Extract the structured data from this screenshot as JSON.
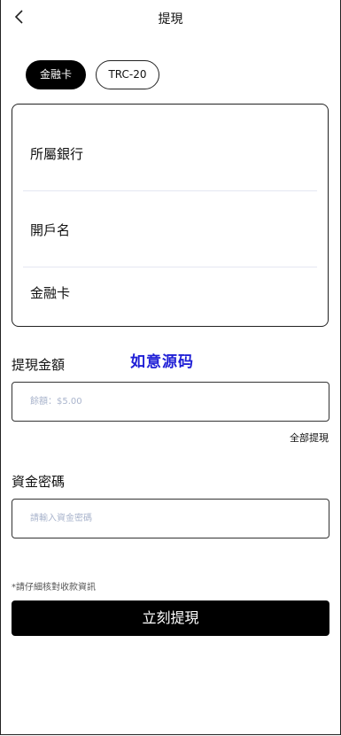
{
  "header": {
    "title": "提現",
    "back_icon": "chevron-left-icon"
  },
  "tabs": [
    {
      "label": "金融卡",
      "active": true
    },
    {
      "label": "TRC-20",
      "active": false
    }
  ],
  "bank_card": {
    "bank_label": "所屬銀行",
    "account_name_label": "開戶名",
    "card_label": "金融卡"
  },
  "amount": {
    "label": "提現金額",
    "placeholder": "餘額：$5.00",
    "withdraw_all": "全部提現"
  },
  "watermark": "如意源码",
  "password": {
    "label": "資金密碼",
    "placeholder": "請輸入資金密碼"
  },
  "notice": "*請仔細核對收款資訊",
  "submit_label": "立刻提現",
  "colors": {
    "primary": "#000000",
    "placeholder": "#a9b4cc",
    "divider": "#e4e6f2",
    "watermark": "#1f1fd6"
  }
}
